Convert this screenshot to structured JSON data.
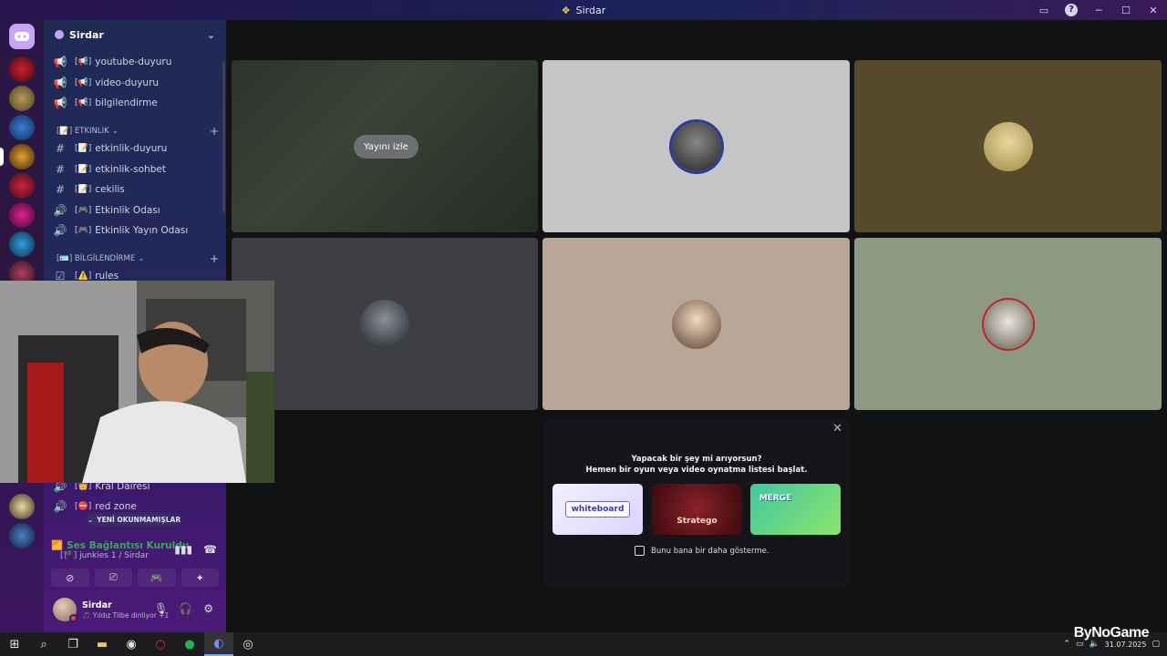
{
  "window": {
    "title": "Sirdar"
  },
  "server": {
    "name": "Sirdar"
  },
  "channels": [
    {
      "icon": "megaphone-icon",
      "emoji": "[📢]",
      "name": "youtube-duyuru"
    },
    {
      "icon": "megaphone-icon",
      "emoji": "[📢]",
      "name": "video-duyuru"
    },
    {
      "icon": "megaphone-icon",
      "emoji": "[📢]",
      "name": "bilgilendirme"
    }
  ],
  "categories": {
    "etkinlik": {
      "label": "[📝] Etkinlik",
      "chev": "⌄"
    },
    "bilgi": {
      "label": "[🪪] BİLGİLENDİRME",
      "chev": "⌄"
    }
  },
  "etkinlik_channels": [
    {
      "icon": "hash-icon",
      "emoji": "[📝]",
      "name": "etkinlik-duyuru"
    },
    {
      "icon": "hash-icon",
      "emoji": "[📝]",
      "name": "etkinlik-sohbet"
    },
    {
      "icon": "hash-icon",
      "emoji": "[📝]",
      "name": "cekilis"
    },
    {
      "icon": "speaker-icon",
      "emoji": "[🎮]",
      "name": "Etkinlik Odası"
    },
    {
      "icon": "speaker-icon",
      "emoji": "[🎮]",
      "name": "Etkinlik Yayın Odası"
    }
  ],
  "bilgi_channels": [
    {
      "icon": "rules-icon",
      "emoji": "[⚠️]",
      "name": "rules"
    }
  ],
  "lower_channels": [
    {
      "icon": "speaker-icon",
      "emoji": "[👑]",
      "name": "Kral Dairesi"
    },
    {
      "icon": "speaker-icon",
      "emoji": "[⛔]",
      "name": "red zone"
    }
  ],
  "unread_pill": "YENİ OKUNMAMIŞLAR",
  "voice": {
    "status": "Ses Bağlantısı Kuruldu",
    "location": "junkies 1 / Sirdar",
    "location_emoji": "[🏴]"
  },
  "user": {
    "name": "Sirdar",
    "activity": "🎵 Yıldız Tilbe dinliyor +1"
  },
  "stage": {
    "watch_stream": "Yayını izle"
  },
  "activity_panel": {
    "line1": "Yapacak bir şey mi arıyorsun?",
    "line2": "Hemen bir oyun veya video oynatma listesi başlat.",
    "cards": [
      "whiteboard",
      "Stratego",
      "MERGE"
    ],
    "checkbox_label": "Bunu bana bir daha gösterme."
  },
  "watermark": "ByNoGame",
  "taskbar": {
    "date": "31.07.2025"
  },
  "colors": {
    "voice_connected": "#3ba55d",
    "dnd": "#ed4245",
    "accent": "#c9a3f5"
  }
}
